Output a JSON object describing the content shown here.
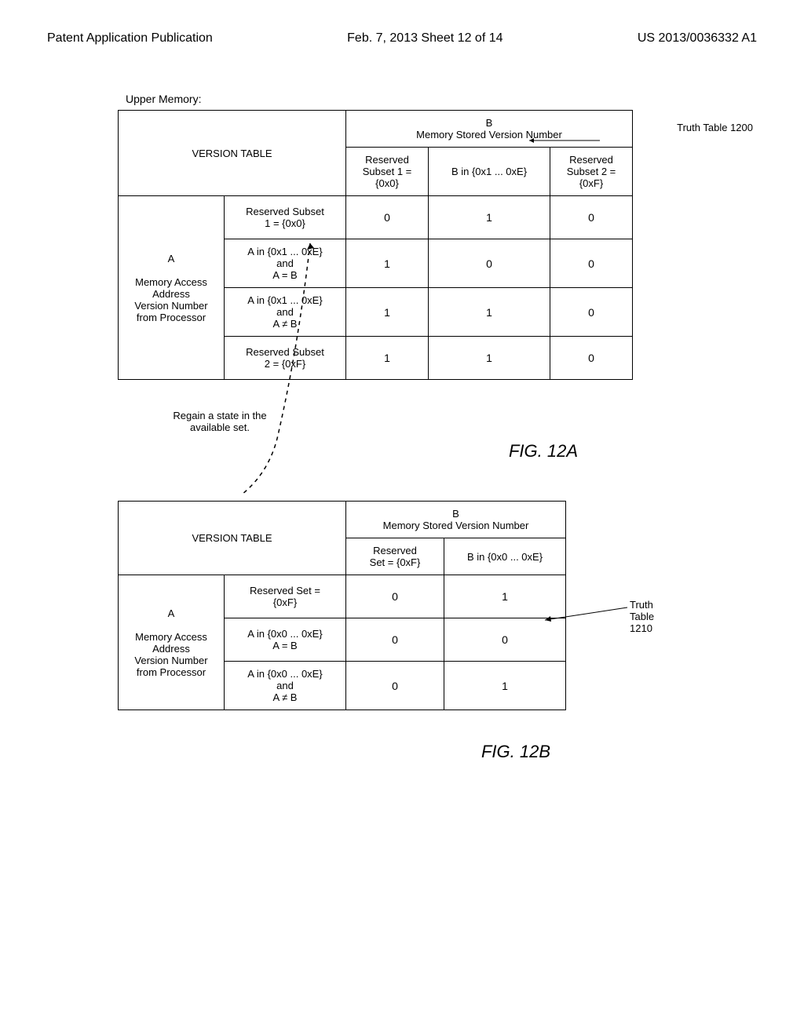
{
  "header": {
    "left": "Patent Application Publication",
    "mid": "Feb. 7, 2013  Sheet 12 of 14",
    "right": "US 2013/0036332 A1"
  },
  "labels": {
    "upper_memory": "Upper Memory:",
    "truth_table_1200": "Truth Table 1200",
    "truth_table_1210_a": "Truth",
    "truth_table_1210_b": "Table",
    "truth_table_1210_c": "1210",
    "regain_l1": "Regain a state in the",
    "regain_l2": "available set."
  },
  "table1200": {
    "version_table": "VERSION TABLE",
    "b_title_l1": "B",
    "b_title_l2": "Memory Stored Version Number",
    "col_b1_l1": "Reserved",
    "col_b1_l2": "Subset 1 =",
    "col_b1_l3": "{0x0}",
    "col_b2": "B in {0x1 ... 0xE}",
    "col_b3_l1": "Reserved",
    "col_b3_l2": "Subset 2 =",
    "col_b3_l3": "{0xF}",
    "a_title_l1": "A",
    "a_title_l2": "Memory Access",
    "a_title_l3": "Address",
    "a_title_l4": "Version Number",
    "a_title_l5": "from Processor",
    "row1_l1": "Reserved Subset",
    "row1_l2": "1 = {0x0}",
    "row2_l1": "A in {0x1 ... 0xE}",
    "row2_l2": "and",
    "row2_l3": "A = B",
    "row3_l1": "A in {0x1 ... 0xE}",
    "row3_l2": "and",
    "row3_l3": "A ≠ B",
    "row4_l1": "Reserved Subset",
    "row4_l2": "2 = {0xF}",
    "v": {
      "r1c1": "0",
      "r1c2": "1",
      "r1c3": "0",
      "r2c1": "1",
      "r2c2": "0",
      "r2c3": "0",
      "r3c1": "1",
      "r3c2": "1",
      "r3c3": "0",
      "r4c1": "1",
      "r4c2": "1",
      "r4c3": "0"
    }
  },
  "table1210": {
    "version_table": "VERSION TABLE",
    "b_title_l1": "B",
    "b_title_l2": "Memory Stored Version Number",
    "col_b1_l1": "Reserved",
    "col_b1_l2": "Set = {0xF}",
    "col_b2": "B in {0x0 ... 0xE}",
    "a_title_l1": "A",
    "a_title_l2": "Memory Access",
    "a_title_l3": "Address",
    "a_title_l4": "Version Number",
    "a_title_l5": "from Processor",
    "row1_l1": "Reserved Set =",
    "row1_l2": "{0xF}",
    "row2_l1": "A in {0x0 ... 0xE}",
    "row2_l2": "A = B",
    "row3_l1": "A in {0x0 ... 0xE}",
    "row3_l2": "and",
    "row3_l3": "A ≠ B",
    "v": {
      "r1c1": "0",
      "r1c2": "1",
      "r2c1": "0",
      "r2c2": "0",
      "r3c1": "0",
      "r3c2": "1"
    }
  },
  "figs": {
    "a": "FIG. 12A",
    "b": "FIG. 12B"
  },
  "chart_data": [
    {
      "type": "table",
      "name": "Truth Table 1200",
      "row_axis": "A (Memory Access Address Version Number from Processor)",
      "col_axis": "B (Memory Stored Version Number)",
      "columns": [
        "Reserved Subset 1 = {0x0}",
        "B in {0x1 ... 0xE}",
        "Reserved Subset 2 = {0xF}"
      ],
      "rows": [
        {
          "label": "Reserved Subset 1 = {0x0}",
          "values": [
            0,
            1,
            0
          ]
        },
        {
          "label": "A in {0x1 ... 0xE} and A = B",
          "values": [
            1,
            0,
            0
          ]
        },
        {
          "label": "A in {0x1 ... 0xE} and A ≠ B",
          "values": [
            1,
            1,
            0
          ]
        },
        {
          "label": "Reserved Subset 2 = {0xF}",
          "values": [
            1,
            1,
            0
          ]
        }
      ]
    },
    {
      "type": "table",
      "name": "Truth Table 1210",
      "row_axis": "A (Memory Access Address Version Number from Processor)",
      "col_axis": "B (Memory Stored Version Number)",
      "columns": [
        "Reserved Set = {0xF}",
        "B in {0x0 ... 0xE}"
      ],
      "rows": [
        {
          "label": "Reserved Set = {0xF}",
          "values": [
            0,
            1
          ]
        },
        {
          "label": "A in {0x0 ... 0xE} A = B",
          "values": [
            0,
            0
          ]
        },
        {
          "label": "A in {0x0 ... 0xE} and A ≠ B",
          "values": [
            0,
            1
          ]
        }
      ]
    }
  ]
}
